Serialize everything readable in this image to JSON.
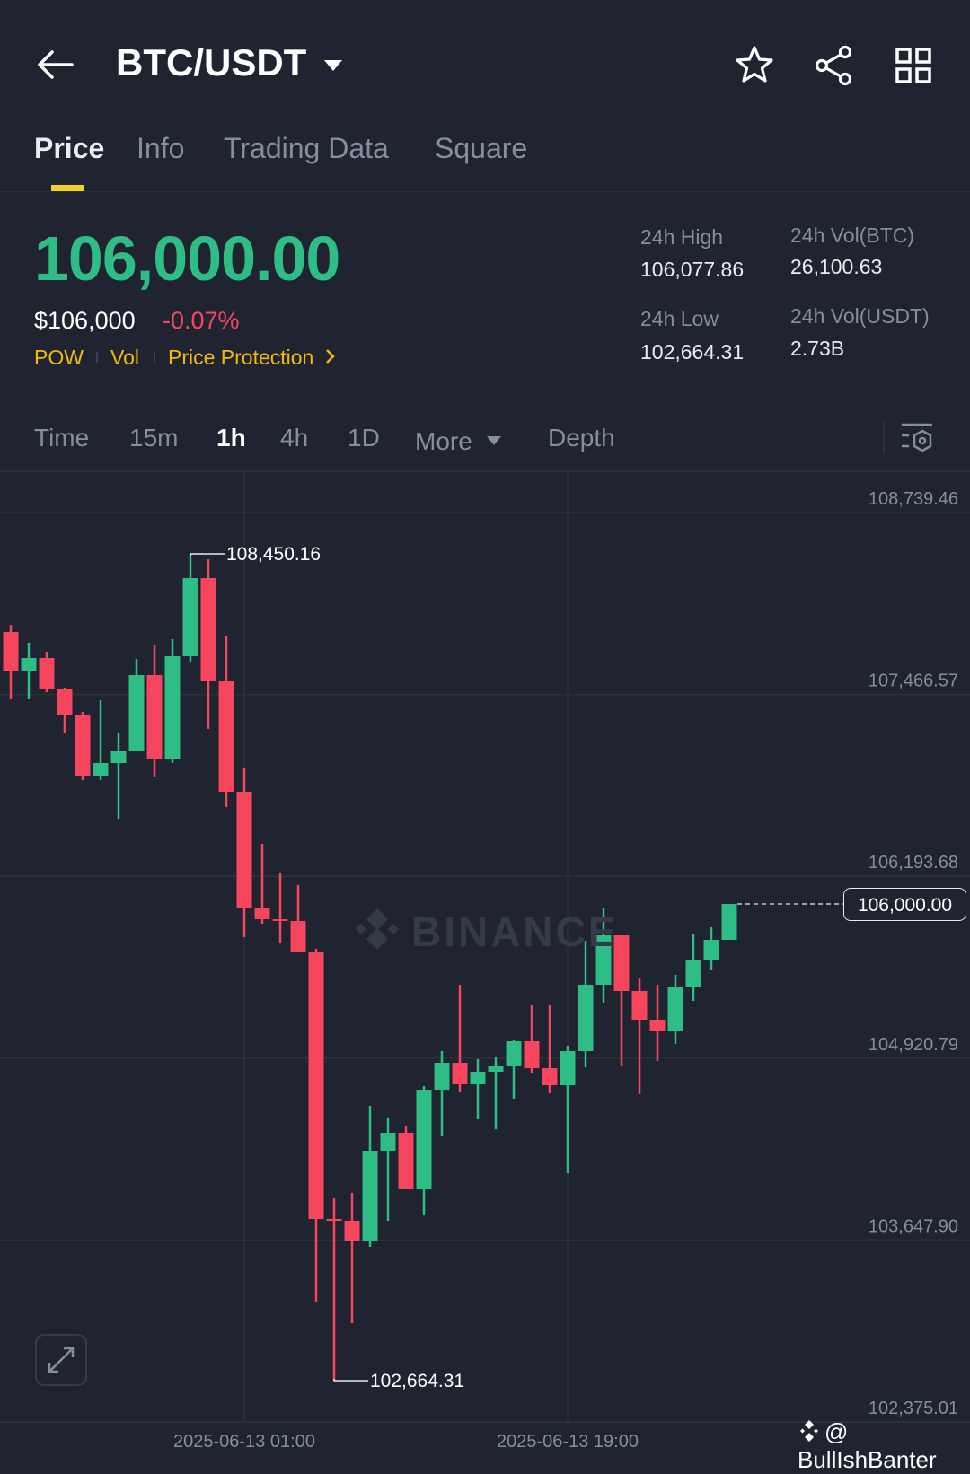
{
  "header": {
    "title": "BTC/USDT",
    "icons": [
      "back-arrow-icon",
      "caret-down-icon",
      "star-icon",
      "share-icon",
      "grid-icon"
    ]
  },
  "tabs": [
    {
      "label": "Price",
      "active": true
    },
    {
      "label": "Info"
    },
    {
      "label": "Trading Data"
    },
    {
      "label": "Square"
    }
  ],
  "price": {
    "last": "106,000.00",
    "usd": "$106,000",
    "change": "-0.07%",
    "tags": [
      "POW",
      "Vol",
      "Price Protection"
    ]
  },
  "stats": {
    "high_label": "24h High",
    "high": "106,077.86",
    "low_label": "24h Low",
    "low": "102,664.31",
    "vol_btc_label": "24h Vol(BTC)",
    "vol_btc": "26,100.63",
    "vol_usdt_label": "24h Vol(USDT)",
    "vol_usdt": "2.73B"
  },
  "intervals": [
    {
      "label": "Time"
    },
    {
      "label": "15m"
    },
    {
      "label": "1h",
      "active": true
    },
    {
      "label": "4h"
    },
    {
      "label": "1D"
    },
    {
      "label": "More"
    },
    {
      "label": "Depth"
    }
  ],
  "colors": {
    "up": "#2ebd85",
    "down": "#f6465d",
    "accent": "#f0b90b",
    "bg": "#1f2430"
  },
  "watermark": "BINANCE",
  "credit": "@ BullIshBanter",
  "chart_data": {
    "type": "candlestick",
    "interval": "1h",
    "ylim": [
      102375.01,
      108739.46
    ],
    "y_ticks": [
      "108,739.46",
      "107,466.57",
      "106,193.68",
      "104,920.79",
      "103,647.90",
      "102,375.01"
    ],
    "y_tick_values": [
      108739.46,
      107466.57,
      106193.68,
      104920.79,
      103647.9,
      102375.01
    ],
    "x_ticks": [
      {
        "index": 13,
        "label": "2025-06-13 01:00"
      },
      {
        "index": 31,
        "label": "2025-06-13 19:00"
      }
    ],
    "high_annotation": {
      "index": 10,
      "value": 108450.16,
      "label": "108,450.16"
    },
    "low_annotation": {
      "index": 18,
      "value": 102664.31,
      "label": "102,664.31"
    },
    "current_price": {
      "value": 106000.0,
      "label": "106,000.00"
    },
    "candles": [
      {
        "o": 107903.8,
        "h": 107954.1,
        "l": 107432.6,
        "c": 107627.4
      },
      {
        "o": 107627.4,
        "h": 107828.5,
        "l": 107432.6,
        "c": 107721.7
      },
      {
        "o": 107721.7,
        "h": 107765.6,
        "l": 107482.9,
        "c": 107501.7
      },
      {
        "o": 107501.7,
        "h": 107514.3,
        "l": 107193.9,
        "c": 107319.5
      },
      {
        "o": 107319.5,
        "h": 107344.7,
        "l": 106867.2,
        "c": 106892.3
      },
      {
        "o": 106892.3,
        "h": 107426.4,
        "l": 106867.2,
        "c": 106986.5
      },
      {
        "o": 106986.5,
        "h": 107193.9,
        "l": 106597.0,
        "c": 107068.2
      },
      {
        "o": 107068.2,
        "h": 107715.4,
        "l": 107068.2,
        "c": 107602.3
      },
      {
        "o": 107602.3,
        "h": 107815.9,
        "l": 106886.0,
        "c": 107018.0
      },
      {
        "o": 107018.0,
        "h": 107853.6,
        "l": 106986.5,
        "c": 107734.2
      },
      {
        "o": 107734.2,
        "h": 108450.16,
        "l": 107696.5,
        "c": 108280.8
      },
      {
        "o": 108280.8,
        "h": 108412.8,
        "l": 107225.3,
        "c": 107558.3
      },
      {
        "o": 107558.3,
        "h": 107872.4,
        "l": 106678.7,
        "c": 106785.5
      },
      {
        "o": 106785.5,
        "h": 106948.8,
        "l": 105767.6,
        "c": 105975.0
      },
      {
        "o": 105975.0,
        "h": 106421.1,
        "l": 105861.9,
        "c": 105893.3
      },
      {
        "o": 105893.3,
        "h": 106220.0,
        "l": 105723.7,
        "c": 105880.7
      },
      {
        "o": 105880.7,
        "h": 106132.1,
        "l": 105667.1,
        "c": 105667.1
      },
      {
        "o": 105667.1,
        "h": 105686.0,
        "l": 103216.7,
        "c": 103794.8
      },
      {
        "o": 103794.8,
        "h": 103939.3,
        "l": 102664.31,
        "c": 103782.2
      },
      {
        "o": 103782.2,
        "h": 103977.0,
        "l": 103066.0,
        "c": 103637.7
      },
      {
        "o": 103637.7,
        "h": 104586.4,
        "l": 103600.0,
        "c": 104272.3
      },
      {
        "o": 104272.3,
        "h": 104504.8,
        "l": 103782.2,
        "c": 104397.9
      },
      {
        "o": 104397.9,
        "h": 104448.2,
        "l": 104002.1,
        "c": 104002.1
      },
      {
        "o": 104002.1,
        "h": 104724.7,
        "l": 103826.2,
        "c": 104699.5
      },
      {
        "o": 104699.5,
        "h": 104969.7,
        "l": 104372.8,
        "c": 104888.0
      },
      {
        "o": 104888.0,
        "h": 105434.6,
        "l": 104687.0,
        "c": 104737.2
      },
      {
        "o": 104737.2,
        "h": 104913.2,
        "l": 104498.5,
        "c": 104825.2
      },
      {
        "o": 104825.2,
        "h": 104925.7,
        "l": 104423.1,
        "c": 104869.2
      },
      {
        "o": 104869.2,
        "h": 105045.1,
        "l": 104636.7,
        "c": 105038.8
      },
      {
        "o": 105038.8,
        "h": 105290.1,
        "l": 104818.9,
        "c": 104850.3
      },
      {
        "o": 104850.3,
        "h": 105296.4,
        "l": 104674.4,
        "c": 104730.9
      },
      {
        "o": 104730.9,
        "h": 105007.4,
        "l": 104115.2,
        "c": 104969.7
      },
      {
        "o": 104969.7,
        "h": 105742.5,
        "l": 104856.6,
        "c": 105434.6
      },
      {
        "o": 105434.6,
        "h": 105975.0,
        "l": 105309.0,
        "c": 105780.2
      },
      {
        "o": 105780.2,
        "h": 105780.2,
        "l": 104862.9,
        "c": 105390.7
      },
      {
        "o": 105390.7,
        "h": 105478.6,
        "l": 104668.1,
        "c": 105189.6
      },
      {
        "o": 105189.6,
        "h": 105434.6,
        "l": 104900.6,
        "c": 105107.9
      },
      {
        "o": 105107.9,
        "h": 105503.8,
        "l": 105020.0,
        "c": 105422.1
      },
      {
        "o": 105422.1,
        "h": 105786.5,
        "l": 105321.6,
        "c": 105610.6
      },
      {
        "o": 105610.6,
        "h": 105836.8,
        "l": 105541.5,
        "c": 105748.8
      },
      {
        "o": 105748.8,
        "h": 106000.0,
        "l": 105748.8,
        "c": 106000.0
      }
    ]
  }
}
